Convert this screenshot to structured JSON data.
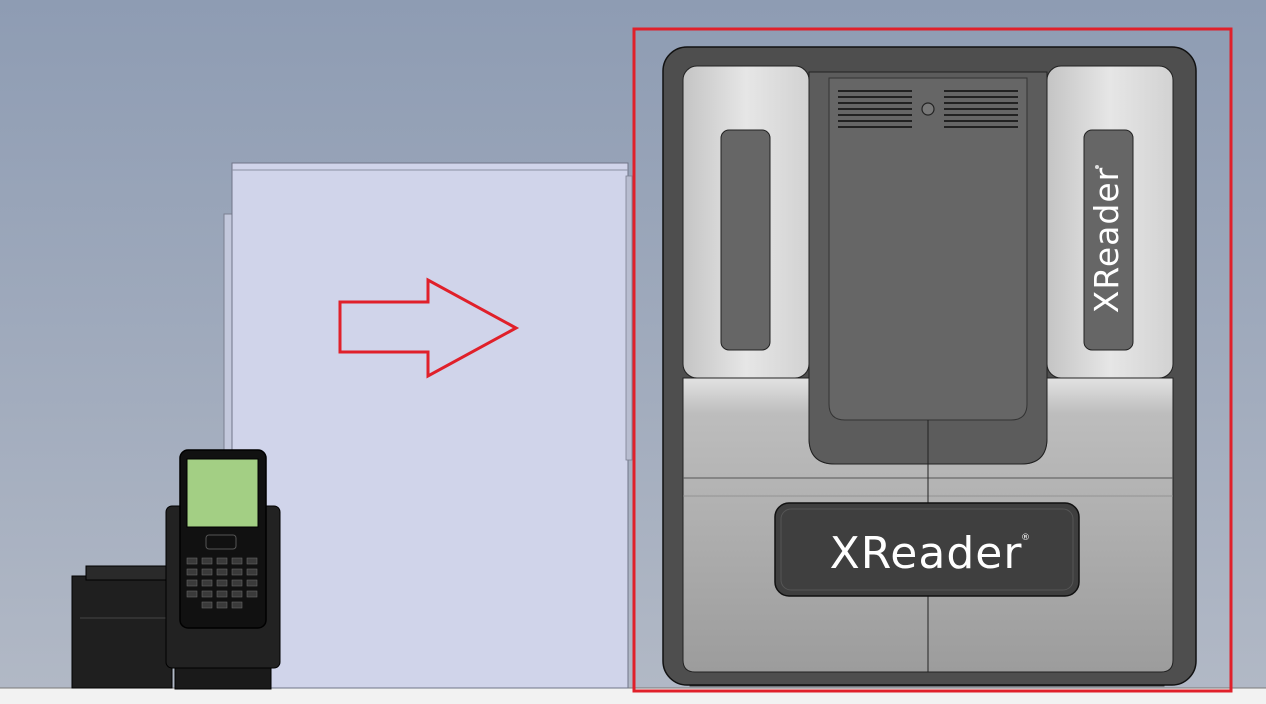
{
  "product": {
    "brand_side": "XReader",
    "brand_front": "XReader",
    "registered_mark": "®"
  },
  "colors": {
    "background_top": "#8e9cb3",
    "background_bottom": "#aeb6c4",
    "panel": "#d0d4ea",
    "highlight_box": "#e0202a",
    "arrow": "#e0202a",
    "body_dark": "#5a5a5a",
    "body_light": "#dcdcdc",
    "terminal_screen": "#a3cf84"
  },
  "icons": {
    "arrow": "right-arrow-icon",
    "terminal": "payment-terminal-icon"
  }
}
